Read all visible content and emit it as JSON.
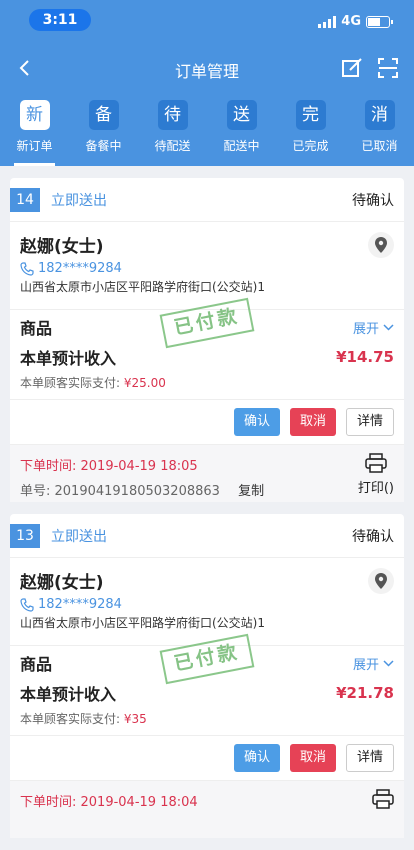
{
  "status": {
    "time": "3:11",
    "network": "4G"
  },
  "nav": {
    "title": "订单管理"
  },
  "tabs": [
    {
      "icon": "新",
      "label": "新订单",
      "active": true
    },
    {
      "icon": "备",
      "label": "备餐中"
    },
    {
      "icon": "待",
      "label": "待配送"
    },
    {
      "icon": "送",
      "label": "配送中"
    },
    {
      "icon": "完",
      "label": "已完成"
    },
    {
      "icon": "消",
      "label": "已取消"
    }
  ],
  "colors": {
    "primary": "#4a93e0",
    "danger": "#d9334e",
    "stamp": "#79bd79"
  },
  "orders": [
    {
      "num": "14",
      "delivery": "立即送出",
      "state": "待确认",
      "name": "赵娜(女士)",
      "phone": "182****9284",
      "address": "山西省太原市小店区平阳路学府街口(公交站)1",
      "goods": "商品",
      "expand": "展开",
      "stamp": "已付款",
      "income_label": "本单预计收入",
      "income": "¥14.75",
      "paid_label": "本单顾客实际支付:",
      "paid": "¥25.00",
      "confirm": "确认",
      "cancel": "取消",
      "detail": "详情",
      "order_time": "下单时间:   2019-04-19 18:05",
      "order_no": "单号:   20190419180503208863",
      "copy": "复制",
      "print": "打印()"
    },
    {
      "num": "13",
      "delivery": "立即送出",
      "state": "待确认",
      "name": "赵娜(女士)",
      "phone": "182****9284",
      "address": "山西省太原市小店区平阳路学府街口(公交站)1",
      "goods": "商品",
      "expand": "展开",
      "stamp": "已付款",
      "income_label": "本单预计收入",
      "income": "¥21.78",
      "paid_label": "本单顾客实际支付:",
      "paid": "¥35",
      "confirm": "确认",
      "cancel": "取消",
      "detail": "详情",
      "order_time": "下单时间:   2019-04-19 18:04",
      "order_no": "",
      "copy": "",
      "print": ""
    }
  ]
}
